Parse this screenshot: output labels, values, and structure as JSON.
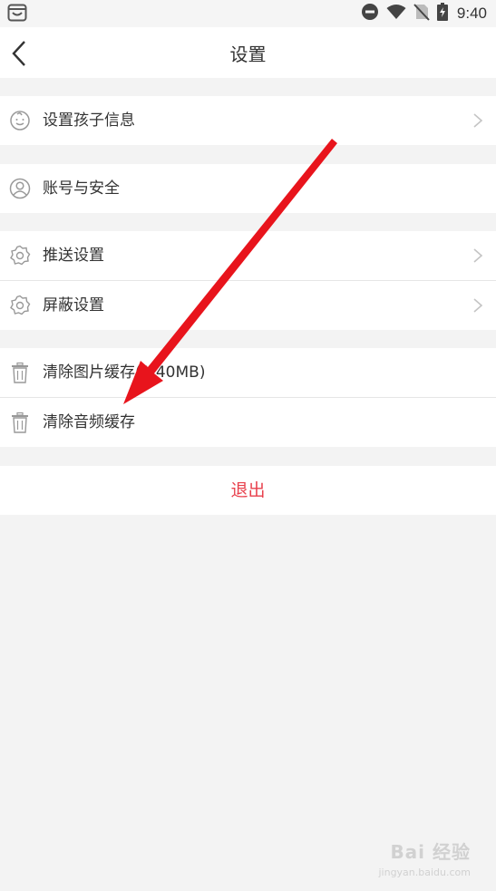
{
  "status_bar": {
    "time": "9:40",
    "icons": [
      "gift-bag-icon",
      "do-not-disturb-icon",
      "wifi-icon",
      "no-sim-icon",
      "battery-charging-icon"
    ]
  },
  "header": {
    "title": "设置",
    "back_icon": "back-chevron-icon"
  },
  "settings": {
    "group1": {
      "items": [
        {
          "label": "设置孩子信息",
          "icon": "child-face-icon"
        }
      ]
    },
    "group2": {
      "items": [
        {
          "label": "账号与安全",
          "icon": "user-icon"
        }
      ]
    },
    "group3": {
      "items": [
        {
          "label": "推送设置",
          "icon": "gear-icon"
        },
        {
          "label": "屏蔽设置",
          "icon": "gear-icon"
        }
      ]
    },
    "group4": {
      "items": [
        {
          "label": "清除图片缓存(1.40MB)",
          "icon": "trash-icon"
        },
        {
          "label": "清除音频缓存",
          "icon": "trash-icon"
        }
      ]
    }
  },
  "logout": {
    "label": "退出"
  },
  "colors": {
    "background": "#f3f3f3",
    "logout_text": "#e8414d",
    "annotation_arrow": "#e8141c"
  },
  "watermark": {
    "text": "Bai 经验",
    "sub": "jingyan.baidu.com"
  }
}
